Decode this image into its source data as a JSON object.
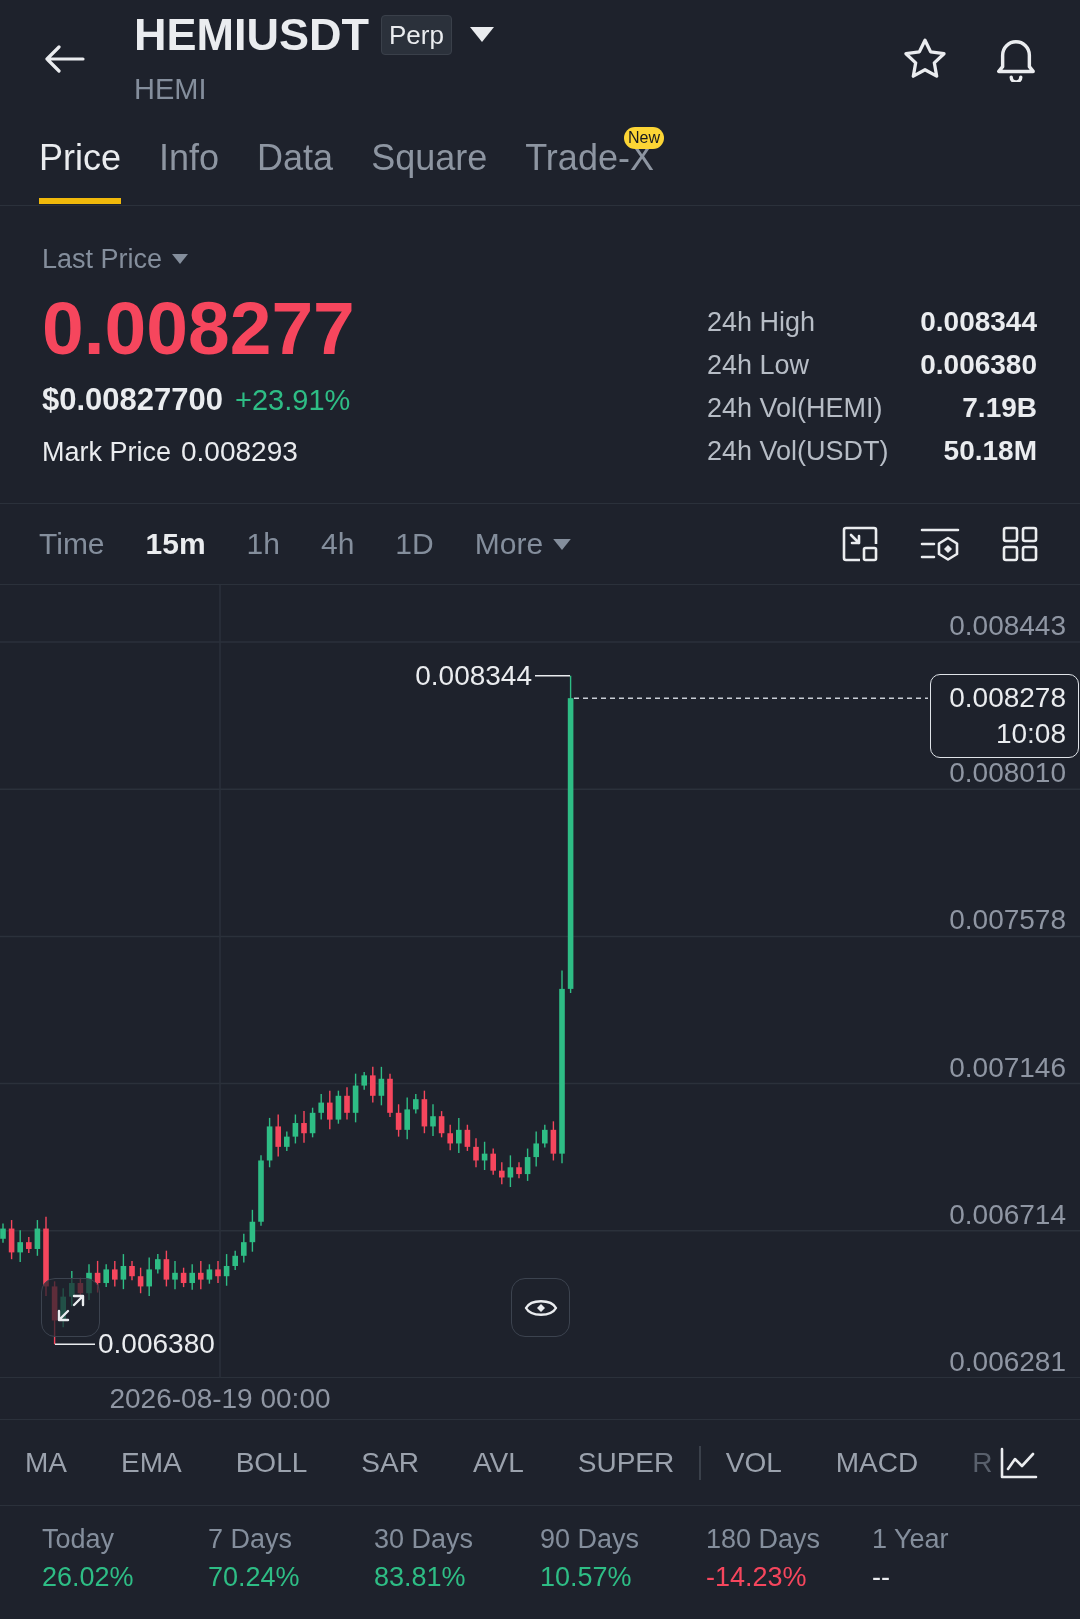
{
  "header": {
    "title": "HEMIUSDT",
    "contract_type": "Perp",
    "subtitle": "HEMI"
  },
  "tabs": [
    {
      "label": "Price",
      "selected": true
    },
    {
      "label": "Info",
      "selected": false
    },
    {
      "label": "Data",
      "selected": false
    },
    {
      "label": "Square",
      "selected": false
    },
    {
      "label": "Trade-X",
      "selected": false,
      "badge": "New"
    }
  ],
  "price_panel": {
    "price_type": "Last Price",
    "last_price": {
      "value": "0.008277",
      "color": "#f6465d"
    },
    "usd_price": "$0.00827700",
    "change_24h": {
      "value": "+23.91%",
      "color": "#2ebd85"
    },
    "mark_price_label": "Mark Price",
    "mark_price": "0.008293",
    "stats": [
      {
        "label": "24h High",
        "value": "0.008344"
      },
      {
        "label": "24h Low",
        "value": "0.006380"
      },
      {
        "label": "24h Vol(HEMI)",
        "value": "7.19B"
      },
      {
        "label": "24h Vol(USDT)",
        "value": "50.18M"
      }
    ]
  },
  "intervals": [
    {
      "label": "Time",
      "selected": false,
      "kind": "option"
    },
    {
      "label": "15m",
      "selected": true,
      "kind": "option"
    },
    {
      "label": "1h",
      "selected": false,
      "kind": "option"
    },
    {
      "label": "4h",
      "selected": false,
      "kind": "option"
    },
    {
      "label": "1D",
      "selected": false,
      "kind": "option"
    },
    {
      "label": "More",
      "selected": false,
      "kind": "dropdown"
    }
  ],
  "chart": {
    "price_axis": [
      "0.008443",
      "0.008010",
      "0.007578",
      "0.007146",
      "0.006714",
      "0.006281"
    ],
    "high_label": "0.008344",
    "low_label": "0.006380",
    "current_price": "0.008278",
    "countdown": "10:08",
    "time_axis": "2026-08-19 00:00"
  },
  "indicators": {
    "main": [
      "MA",
      "EMA",
      "BOLL",
      "SAR",
      "AVL",
      "SUPER"
    ],
    "sub": [
      "VOL",
      "MACD",
      "R"
    ]
  },
  "performance": [
    {
      "period": "Today",
      "change": "26.02%",
      "color": "#2ebd85"
    },
    {
      "period": "7 Days",
      "change": "70.24%",
      "color": "#2ebd85"
    },
    {
      "period": "30 Days",
      "change": "83.81%",
      "color": "#2ebd85"
    },
    {
      "period": "90 Days",
      "change": "10.57%",
      "color": "#2ebd85"
    },
    {
      "period": "180 Days",
      "change": "-14.23%",
      "color": "#f6465d"
    },
    {
      "period": "1 Year",
      "change": "--",
      "color": "#eaecef"
    }
  ]
}
